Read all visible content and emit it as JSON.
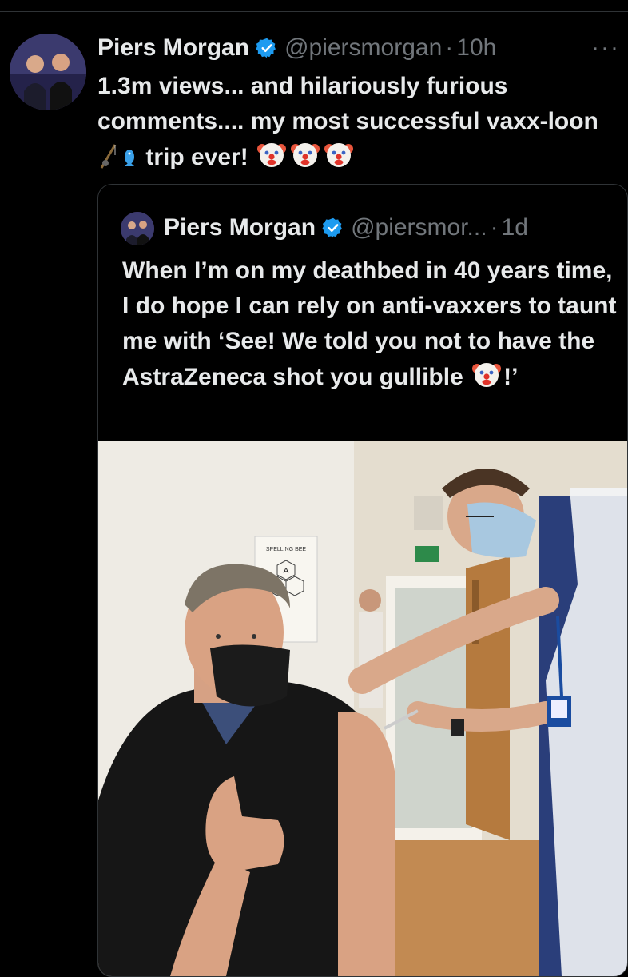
{
  "tweet": {
    "author_name": "Piers Morgan",
    "handle": "@piersmorgan",
    "separator": "·",
    "time": "10h",
    "more_label": "···",
    "text_part1": "1.3m views... and hilariously furious comments.... my most successful vaxx-loon ",
    "text_part2": " trip ever! ",
    "inline_icons": [
      "fishing-pole-icon",
      "fish-icon",
      "clown-face-icon"
    ]
  },
  "quoted_tweet": {
    "author_name": "Piers Morgan",
    "handle": "@piersmor...",
    "separator": "·",
    "time": "1d",
    "text_part1": "When I’m on my deathbed in 40 years time, I do hope I can rely on anti-vaxxers to taunt me with ‘See! We told you not to have the AstraZeneca shot you gullible ",
    "text_part2": "!’",
    "photo_sign": "SPELLING BEE",
    "photo_hex_letter": "A"
  },
  "colors": {
    "background": "#000000",
    "text_primary": "#e7e9ea",
    "text_secondary": "#71767b",
    "border": "#2f3336",
    "verified_blue": "#1d9bf0"
  }
}
